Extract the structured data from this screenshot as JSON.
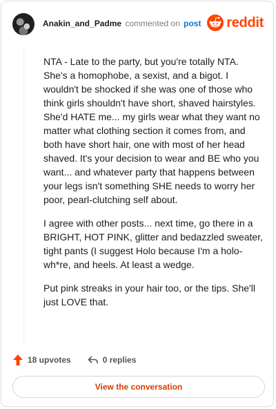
{
  "header": {
    "username": "Anakin_and_Padme",
    "action_text": "commented on",
    "post_link": "post",
    "brand": "reddit",
    "brand_color": "#ff4500"
  },
  "comment": {
    "paragraphs": [
      "NTA - Late to the party, but you're totally NTA. She's a homophobe, a sexist, and a bigot. I wouldn't be shocked if she was one of those who think girls shouldn't have short, shaved hairstyles. She'd HATE me... my girls wear what they want no matter what clothing section it comes from, and both have short hair, one with most of her head shaved. It's your decision to wear and BE who you want... and whatever party that happens between your legs isn't something SHE needs to worry her poor, pearl-clutching self about.",
      "I agree with other posts... next time, go there in a BRIGHT, HOT PINK, glitter and bedazzled sweater, tight pants (I suggest Holo because I'm a holo-wh*re, and heels. At least a wedge.",
      "Put pink streaks in your hair too, or the tips. She'll just LOVE that."
    ]
  },
  "actions": {
    "upvotes": "18 upvotes",
    "upvote_icon": "upvote-arrow-icon",
    "upvote_color": "#ff4500",
    "replies": "0 replies",
    "reply_icon": "reply-arrow-icon"
  },
  "footer": {
    "view_button": "View the conversation",
    "view_button_color": "#d93a00"
  }
}
